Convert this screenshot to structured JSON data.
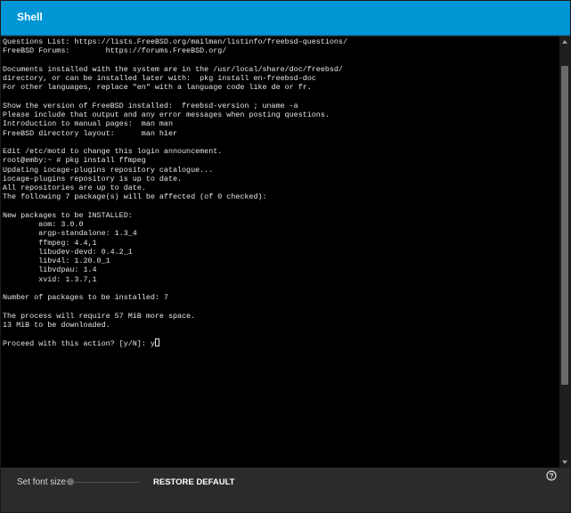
{
  "header": {
    "title": "Shell"
  },
  "terminal": {
    "lines": [
      "Questions List: https://lists.FreeBSD.org/mailman/listinfo/freebsd-questions/",
      "FreeBSD Forums:        https://forums.FreeBSD.org/",
      "",
      "Documents installed with the system are in the /usr/local/share/doc/freebsd/",
      "directory, or can be installed later with:  pkg install en-freebsd-doc",
      "For other languages, replace \"en\" with a language code like de or fr.",
      "",
      "Show the version of FreeBSD installed:  freebsd-version ; uname -a",
      "Please include that output and any error messages when posting questions.",
      "Introduction to manual pages:  man man",
      "FreeBSD directory layout:      man hier",
      "",
      "Edit /etc/motd to change this login announcement.",
      "root@emby:~ # pkg install ffmpeg",
      "Updating iocage-plugins repository catalogue...",
      "iocage-plugins repository is up to date.",
      "All repositories are up to date.",
      "The following 7 package(s) will be affected (of 0 checked):",
      "",
      "New packages to be INSTALLED:",
      "        aom: 3.0.0",
      "        argp-standalone: 1.3_4",
      "        ffmpeg: 4.4,1",
      "        libudev-devd: 0.4.2_1",
      "        libv4l: 1.20.0_1",
      "        libvdpau: 1.4",
      "        xvid: 1.3.7,1",
      "",
      "Number of packages to be installed: 7",
      "",
      "The process will require 57 MiB more space.",
      "13 MiB to be downloaded.",
      "",
      "Proceed with this action? [y/N]: y"
    ],
    "scroll_position": 0.23
  },
  "footer": {
    "font_size_label": "Set font size",
    "font_size_value": 0,
    "restore_label": "RESTORE DEFAULT",
    "help_icon": "help-circle-icon"
  },
  "colors": {
    "header_bg": "#0095d5",
    "terminal_bg": "#000000",
    "terminal_fg": "#e6e6e6",
    "panel_bg": "#2b2b2b"
  }
}
